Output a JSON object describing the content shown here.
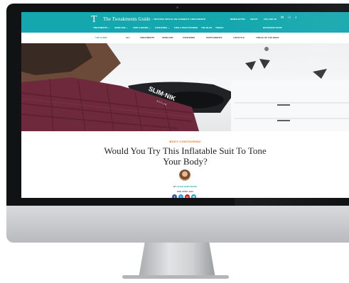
{
  "site": {
    "logo_mark": "T",
    "logo_text": "The Tweakments Guide",
    "tagline": "• TRUSTED ADVICE ON COSMETIC TREATMENTS",
    "util_links": [
      "NEWSLETTER",
      "ABOUT",
      "FOLLOW US"
    ],
    "main_nav": [
      "TREATMENTS ⌄",
      "SKINCARE ⌄",
      "FIND A BRAND ⌄",
      "CONCERNS ⌄",
      "FIND A PRACTITIONER",
      "THE BLOG",
      "VIDEOS",
      "BOOKSHOP SHOP"
    ],
    "sub_nav": [
      "THE CLINIC",
      "ALL",
      "TREATMENTS",
      "SKINCARE",
      "CONCERNS",
      "SUPPLEMENTS",
      "LIFESTYLE",
      "TWEAK OF THE WEEK"
    ]
  },
  "hero": {
    "suit_brand": "SLIM·NIK",
    "suit_brand_sub": "A  C  T  I  V  E"
  },
  "article": {
    "category": "BODY CONTOURING",
    "title": "Would You Try This Inflatable Suit To Tone Your Body?",
    "byline_prefix": "BY",
    "author": "ALICE HART-DAVIS",
    "date": "2ND APRIL 2021"
  },
  "share": [
    {
      "icon": "facebook-icon",
      "glyph": "f",
      "color": "#3b5998"
    },
    {
      "icon": "twitter-icon",
      "glyph": "t",
      "color": "#1da1f2"
    },
    {
      "icon": "pinterest-icon",
      "glyph": "p",
      "color": "#cb2027"
    },
    {
      "icon": "email-icon",
      "glyph": "✉",
      "color": "#14a7ad"
    }
  ],
  "colors": {
    "brand_teal": "#14a7ad",
    "category_orange": "#e57428",
    "suit_maroon": "#6e2a3c"
  }
}
